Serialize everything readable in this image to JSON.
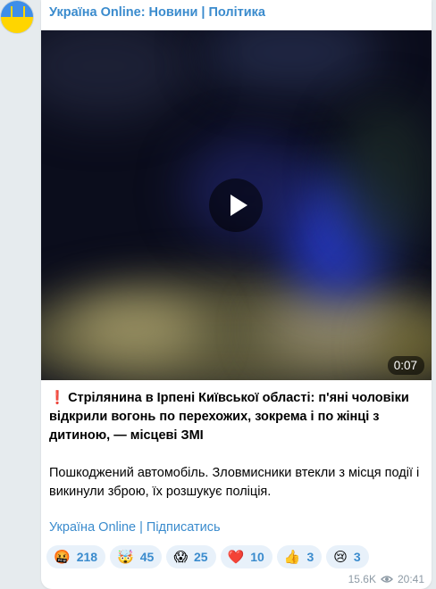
{
  "post": {
    "sender": "Україна Online: Новини | Політика",
    "video": {
      "duration": "0:07"
    },
    "headline_bang": "❗",
    "headline": "Стрілянина в Ірпені Київської області: п'яні чоловіки відкрили вогонь по перехожих, зокрема і по жінці з дитиною, — місцеві ЗМІ",
    "body": "Пошкоджений автомобіль. Зловмисники втекли з місця події і викинули зброю, їх розшукує поліція.",
    "channel_link": "Україна Online | Підписатись",
    "reactions": [
      {
        "emoji": "🤬",
        "count": "218"
      },
      {
        "emoji": "🤯",
        "count": "45"
      },
      {
        "emoji": "😱",
        "count": "25"
      },
      {
        "emoji": "❤️",
        "count": "10"
      },
      {
        "emoji": "👍",
        "count": "3"
      },
      {
        "emoji": "😢",
        "count": "3"
      }
    ],
    "views": "15.6K",
    "time": "20:41"
  },
  "colors": {
    "accent": "#3a8bcd",
    "background": "#e6ebee",
    "bubble": "#ffffff",
    "reaction_bg": "#e8f1fa"
  }
}
